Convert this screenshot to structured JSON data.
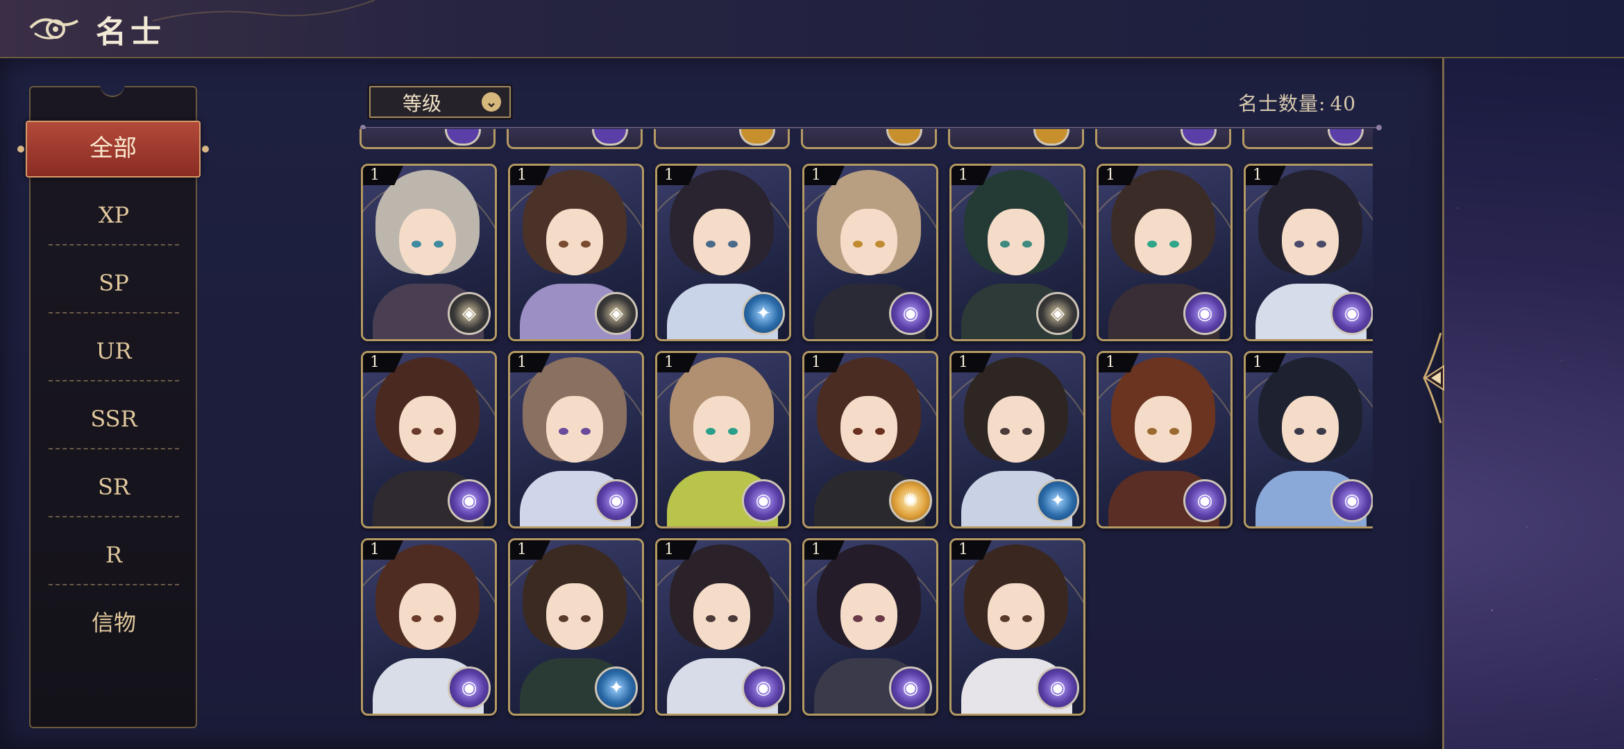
{
  "header": {
    "title": "名士"
  },
  "sidebar": {
    "active": "全部",
    "items": [
      "XP",
      "SP",
      "UR",
      "SSR",
      "SR",
      "R",
      "信物"
    ]
  },
  "toolbar": {
    "sort_label": "等级",
    "count_label": "名士数量:",
    "count_value": "40"
  },
  "cards": [
    {
      "level": "1",
      "badge": "compass",
      "hair": "#bdb6ad",
      "body": "#4a3f52",
      "eye": "#3f8aa0"
    },
    {
      "level": "1",
      "badge": "compass",
      "hair": "#4a3228",
      "body": "#9c8fc4",
      "eye": "#7a4a30"
    },
    {
      "level": "1",
      "badge": "blue-crest",
      "hair": "#2a2430",
      "body": "#c9d4e8",
      "eye": "#4a6a8a"
    },
    {
      "level": "1",
      "badge": "purple-orb",
      "hair": "#b89f82",
      "body": "#2a2a36",
      "eye": "#c08a30"
    },
    {
      "level": "1",
      "badge": "compass",
      "hair": "#233b34",
      "body": "#2e3a38",
      "eye": "#3f8a80"
    },
    {
      "level": "1",
      "badge": "purple-orb",
      "hair": "#3b2c28",
      "body": "#3a2e36",
      "eye": "#2fa58a"
    },
    {
      "level": "1",
      "badge": "purple-orb",
      "hair": "#24222e",
      "body": "#d5dcea",
      "eye": "#4a4a6a"
    },
    {
      "level": "1",
      "badge": "purple-orb",
      "hair": "#4a2a20",
      "body": "#2e2a30",
      "eye": "#6a3a2a"
    },
    {
      "level": "1",
      "badge": "purple-orb",
      "hair": "#8a7060",
      "body": "#cfd6ea",
      "eye": "#6a4a9a"
    },
    {
      "level": "1",
      "badge": "purple-orb",
      "hair": "#b09070",
      "body": "#b8c44a",
      "eye": "#2aa08a"
    },
    {
      "level": "1",
      "badge": "gold-orb",
      "hair": "#4a2c22",
      "body": "#2a2a2e",
      "eye": "#6a3020"
    },
    {
      "level": "1",
      "badge": "blue-crest",
      "hair": "#2e2622",
      "body": "#c8d2e4",
      "eye": "#4a3a3a"
    },
    {
      "level": "1",
      "badge": "purple-orb",
      "hair": "#6a3420",
      "body": "#5a2e24",
      "eye": "#9a6a30"
    },
    {
      "level": "1",
      "badge": "purple-orb",
      "hair": "#1e2230",
      "body": "#8aa8d8",
      "eye": "#3a3a4a"
    },
    {
      "level": "1",
      "badge": "purple-orb",
      "hair": "#4e2c22",
      "body": "#d8dde8",
      "eye": "#6a3a2a"
    },
    {
      "level": "1",
      "badge": "blue-crest",
      "hair": "#3a2a22",
      "body": "#2a3a34",
      "eye": "#5a3a2a"
    },
    {
      "level": "1",
      "badge": "purple-orb",
      "hair": "#2a2228",
      "body": "#d8dce8",
      "eye": "#4a3a3a"
    },
    {
      "level": "1",
      "badge": "purple-orb",
      "hair": "#241c28",
      "body": "#3a3a4a",
      "eye": "#6a3a4a"
    },
    {
      "level": "1",
      "badge": "purple-orb",
      "hair": "#3a2820",
      "body": "#e6e4e8",
      "eye": "#5a3a2a"
    }
  ],
  "partial_badges": [
    "purple-orb",
    "purple-orb",
    "gold-orb",
    "gold-orb",
    "gold-orb",
    "purple-orb",
    "purple-orb"
  ],
  "colors": {
    "accent_gold": "#b59a63",
    "active_tab": "#a23a2e"
  }
}
